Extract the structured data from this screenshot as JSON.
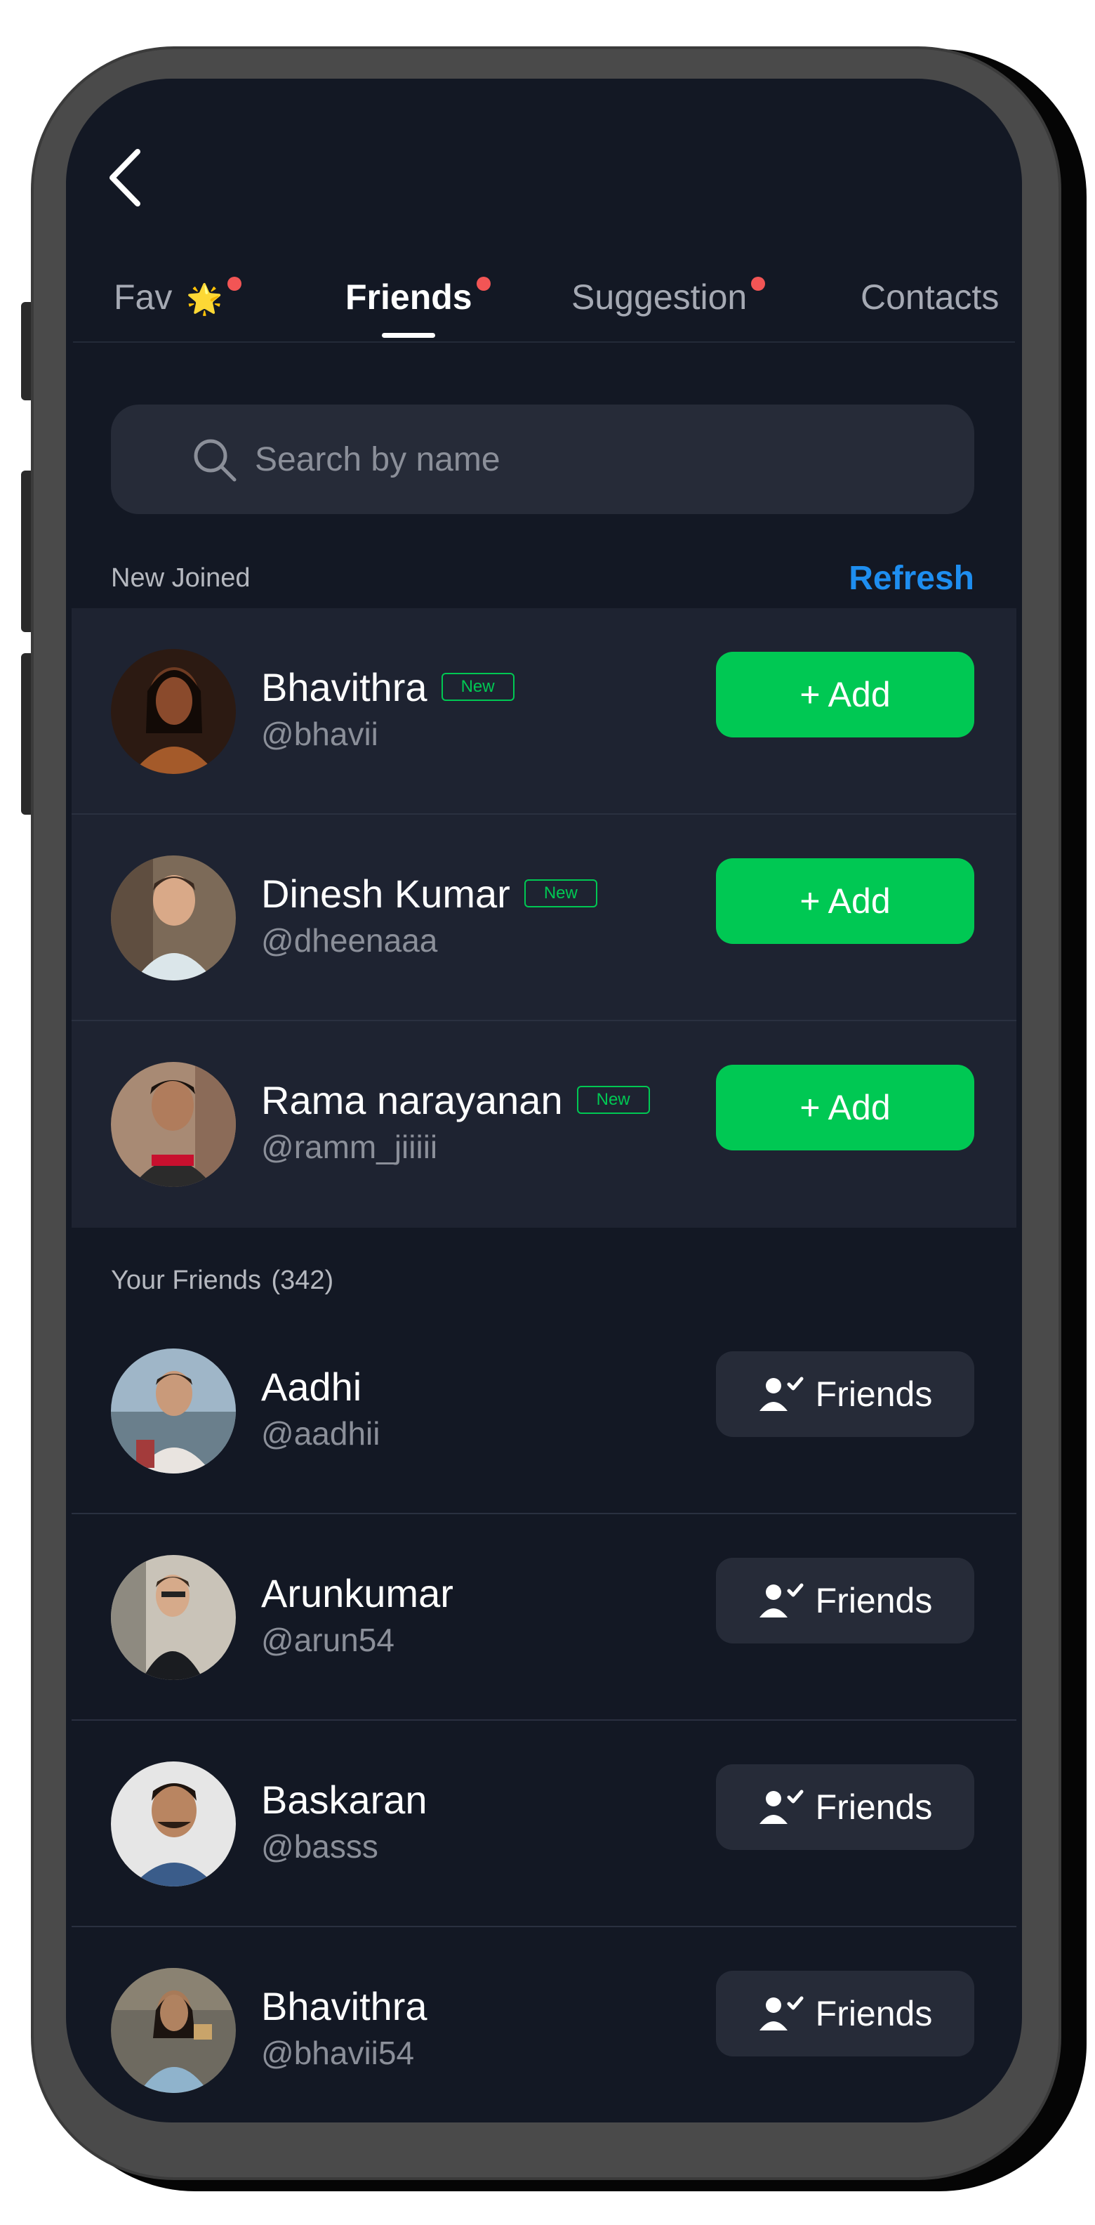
{
  "tabs": [
    {
      "label": "Fav",
      "emoji": "🌟",
      "dot": true,
      "active": false
    },
    {
      "label": "Friends",
      "dot": true,
      "active": true
    },
    {
      "label": "Suggestion",
      "dot": true,
      "active": false
    },
    {
      "label": "Contacts",
      "dot": false,
      "active": false
    }
  ],
  "search": {
    "placeholder": "Search by name"
  },
  "new_joined": {
    "title": "New Joined",
    "refresh_label": "Refresh",
    "badge_label": "New",
    "add_label": "+ Add",
    "users": [
      {
        "name": "Bhavithra",
        "handle": "@bhavii"
      },
      {
        "name": "Dinesh Kumar",
        "handle": "@dheenaaa"
      },
      {
        "name": "Rama narayanan",
        "handle": "@ramm_jiiiii"
      }
    ]
  },
  "friends": {
    "title": "Your Friends",
    "count": "(342)",
    "button_label": "Friends",
    "users": [
      {
        "name": "Aadhi",
        "handle": "@aadhii"
      },
      {
        "name": "Arunkumar",
        "handle": "@arun54"
      },
      {
        "name": "Baskaran",
        "handle": "@basss"
      },
      {
        "name": "Bhavithra",
        "handle": "@bhavii54"
      }
    ]
  },
  "colors": {
    "background": "#131824",
    "card": "#1e2331",
    "accent_green": "#00c853",
    "accent_blue": "#1e8ef0",
    "notification_dot": "#f25555"
  },
  "icons": [
    "back-arrow-icon",
    "search-icon",
    "user-check-icon"
  ]
}
